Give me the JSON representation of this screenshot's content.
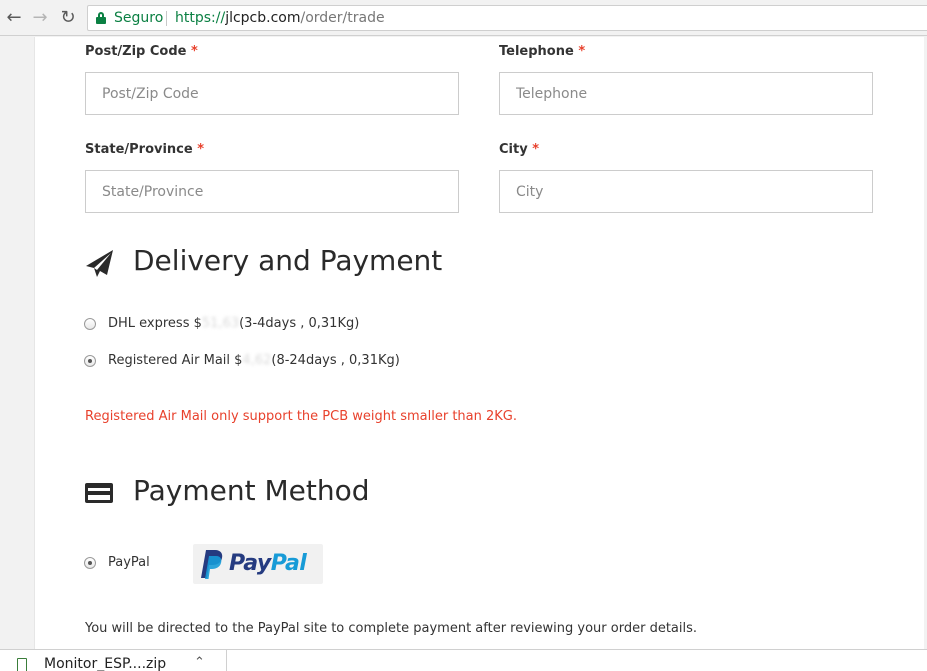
{
  "browser": {
    "secure_label": "Seguro",
    "url_scheme": "https://",
    "url_host": "jlcpcb.com",
    "url_path": "/order/trade"
  },
  "form": {
    "postcode": {
      "label": "Post/Zip Code",
      "required": "*",
      "placeholder": "Post/Zip Code"
    },
    "telephone": {
      "label": "Telephone",
      "required": "*",
      "placeholder": "Telephone"
    },
    "state": {
      "label": "State/Province",
      "required": "*",
      "placeholder": "State/Province"
    },
    "city": {
      "label": "City",
      "required": "*",
      "placeholder": "City"
    }
  },
  "delivery": {
    "title": "Delivery and Payment",
    "icon": "paper-plane-icon",
    "options": [
      {
        "name": "DHL express $",
        "price": "51,63",
        "details": "(3-4days , 0,31Kg)",
        "selected": false
      },
      {
        "name": "Registered Air Mail $",
        "price": "4,62",
        "details": "(8-24days , 0,31Kg)",
        "selected": true
      }
    ],
    "warning": "Registered Air Mail only support the PCB weight smaller than 2KG."
  },
  "payment": {
    "title": "Payment Method",
    "icon": "credit-card-icon",
    "paypal_label": "PayPal",
    "paypal_logo": {
      "pay": "Pay",
      "pal": "Pal"
    },
    "note": "You will be directed to the PayPal site to complete payment after reviewing your order details."
  },
  "downloads": {
    "file_name": "Monitor_ESP....zip"
  },
  "colors": {
    "required": "#e8412c",
    "secure_green": "#0b8043",
    "paypal_dark": "#253b80",
    "paypal_light": "#179bd7"
  }
}
